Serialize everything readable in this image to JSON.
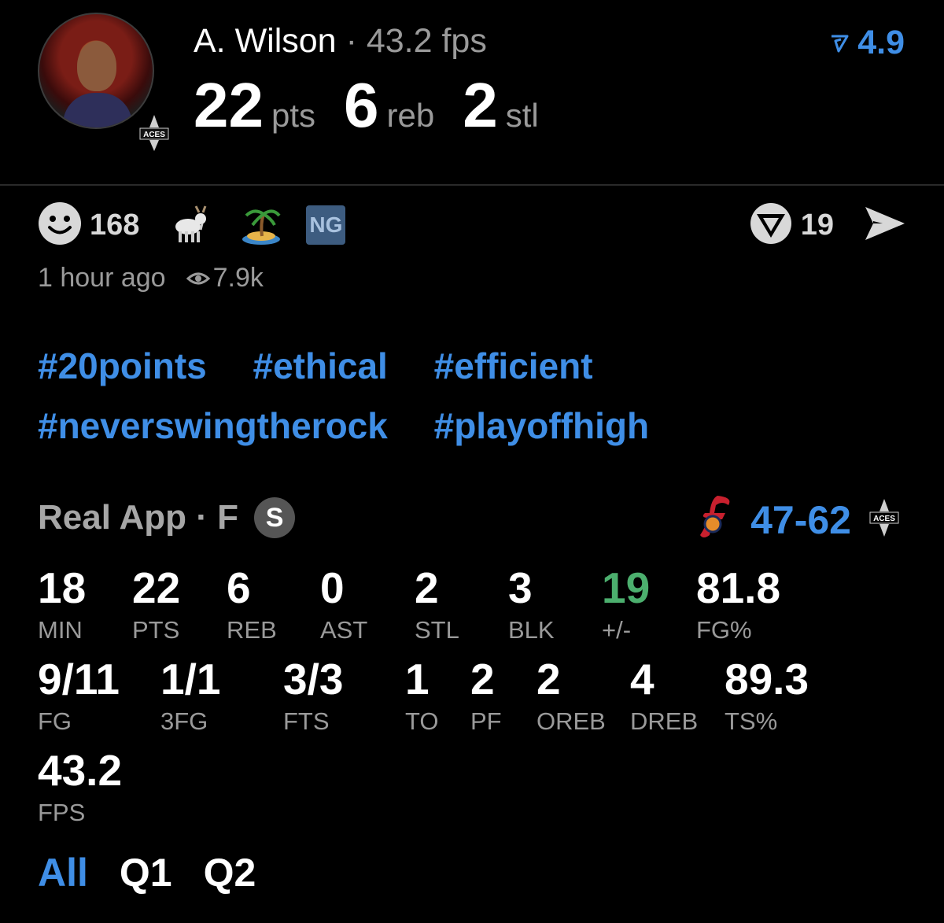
{
  "header": {
    "player_name": "A. Wilson",
    "separator": "·",
    "fps_text": "43.2 fps",
    "rating": "4.9",
    "team_badge": "ACES",
    "big_stats": [
      {
        "value": "22",
        "unit": "pts"
      },
      {
        "value": "6",
        "unit": "reb"
      },
      {
        "value": "2",
        "unit": "stl"
      }
    ]
  },
  "reactions": {
    "smile_count": "168",
    "badge_ng": "NG",
    "comment_count": "19"
  },
  "meta": {
    "time_ago": "1 hour ago",
    "views": "7.9k"
  },
  "hashtags": {
    "row1": [
      "#20points",
      "#ethical",
      "#efficient"
    ],
    "row2": [
      "#neverswingtherock",
      "#playoffhigh"
    ]
  },
  "game": {
    "label": "Real App · F",
    "status_badge": "S",
    "score": "47-62",
    "away_badge": "ACES"
  },
  "stats_row1": [
    {
      "value": "18",
      "label": "MIN"
    },
    {
      "value": "22",
      "label": "PTS"
    },
    {
      "value": "6",
      "label": "REB"
    },
    {
      "value": "0",
      "label": "AST"
    },
    {
      "value": "2",
      "label": "STL"
    },
    {
      "value": "3",
      "label": "BLK"
    },
    {
      "value": "19",
      "label": "+/-"
    },
    {
      "value": "81.8",
      "label": "FG%"
    }
  ],
  "stats_row2": [
    {
      "value": "9/11",
      "label": "FG"
    },
    {
      "value": "1/1",
      "label": "3FG"
    },
    {
      "value": "3/3",
      "label": "FTS"
    },
    {
      "value": "1",
      "label": "TO"
    },
    {
      "value": "2",
      "label": "PF"
    },
    {
      "value": "2",
      "label": "OREB"
    },
    {
      "value": "4",
      "label": "DREB"
    },
    {
      "value": "89.3",
      "label": "TS%"
    }
  ],
  "stats_row3": [
    {
      "value": "43.2",
      "label": "FPS"
    }
  ],
  "tabs": [
    "All",
    "Q1",
    "Q2"
  ],
  "colors": {
    "accent": "#3f8ee6",
    "positive": "#4caf6e",
    "muted": "#9a9a9a"
  }
}
